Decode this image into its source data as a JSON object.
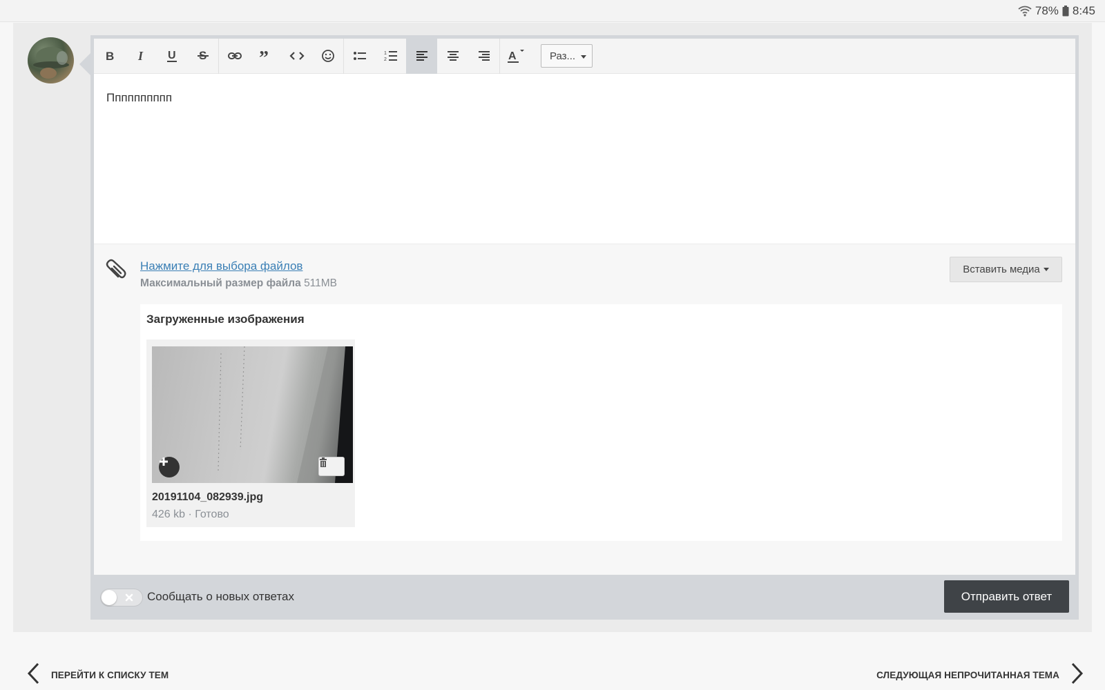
{
  "status_bar": {
    "battery": "78%",
    "time": "8:45"
  },
  "editor": {
    "text": "Пппппппппп",
    "size_select": "Раз..."
  },
  "attachments": {
    "select_link": "Нажмите для выбора файлов",
    "max_label": "Максимальный размер файла",
    "max_value": "511MB",
    "insert_media": "Вставить медиа",
    "uploaded_title": "Загруженные изображения",
    "files": [
      {
        "name": "20191104_082939.jpg",
        "meta": "426 kb · Готово"
      }
    ]
  },
  "footer": {
    "notify_label": "Сообщать о новых ответах",
    "submit": "Отправить ответ"
  },
  "navigation": {
    "prev": "ПЕРЕЙТИ К СПИСКУ ТЕМ",
    "next": "СЛЕДУЮЩАЯ НЕПРОЧИТАННАЯ ТЕМА"
  },
  "colors": {
    "link": "#3a7fb5",
    "submit_bg": "#3f4347",
    "frame": "#d3d6da"
  }
}
